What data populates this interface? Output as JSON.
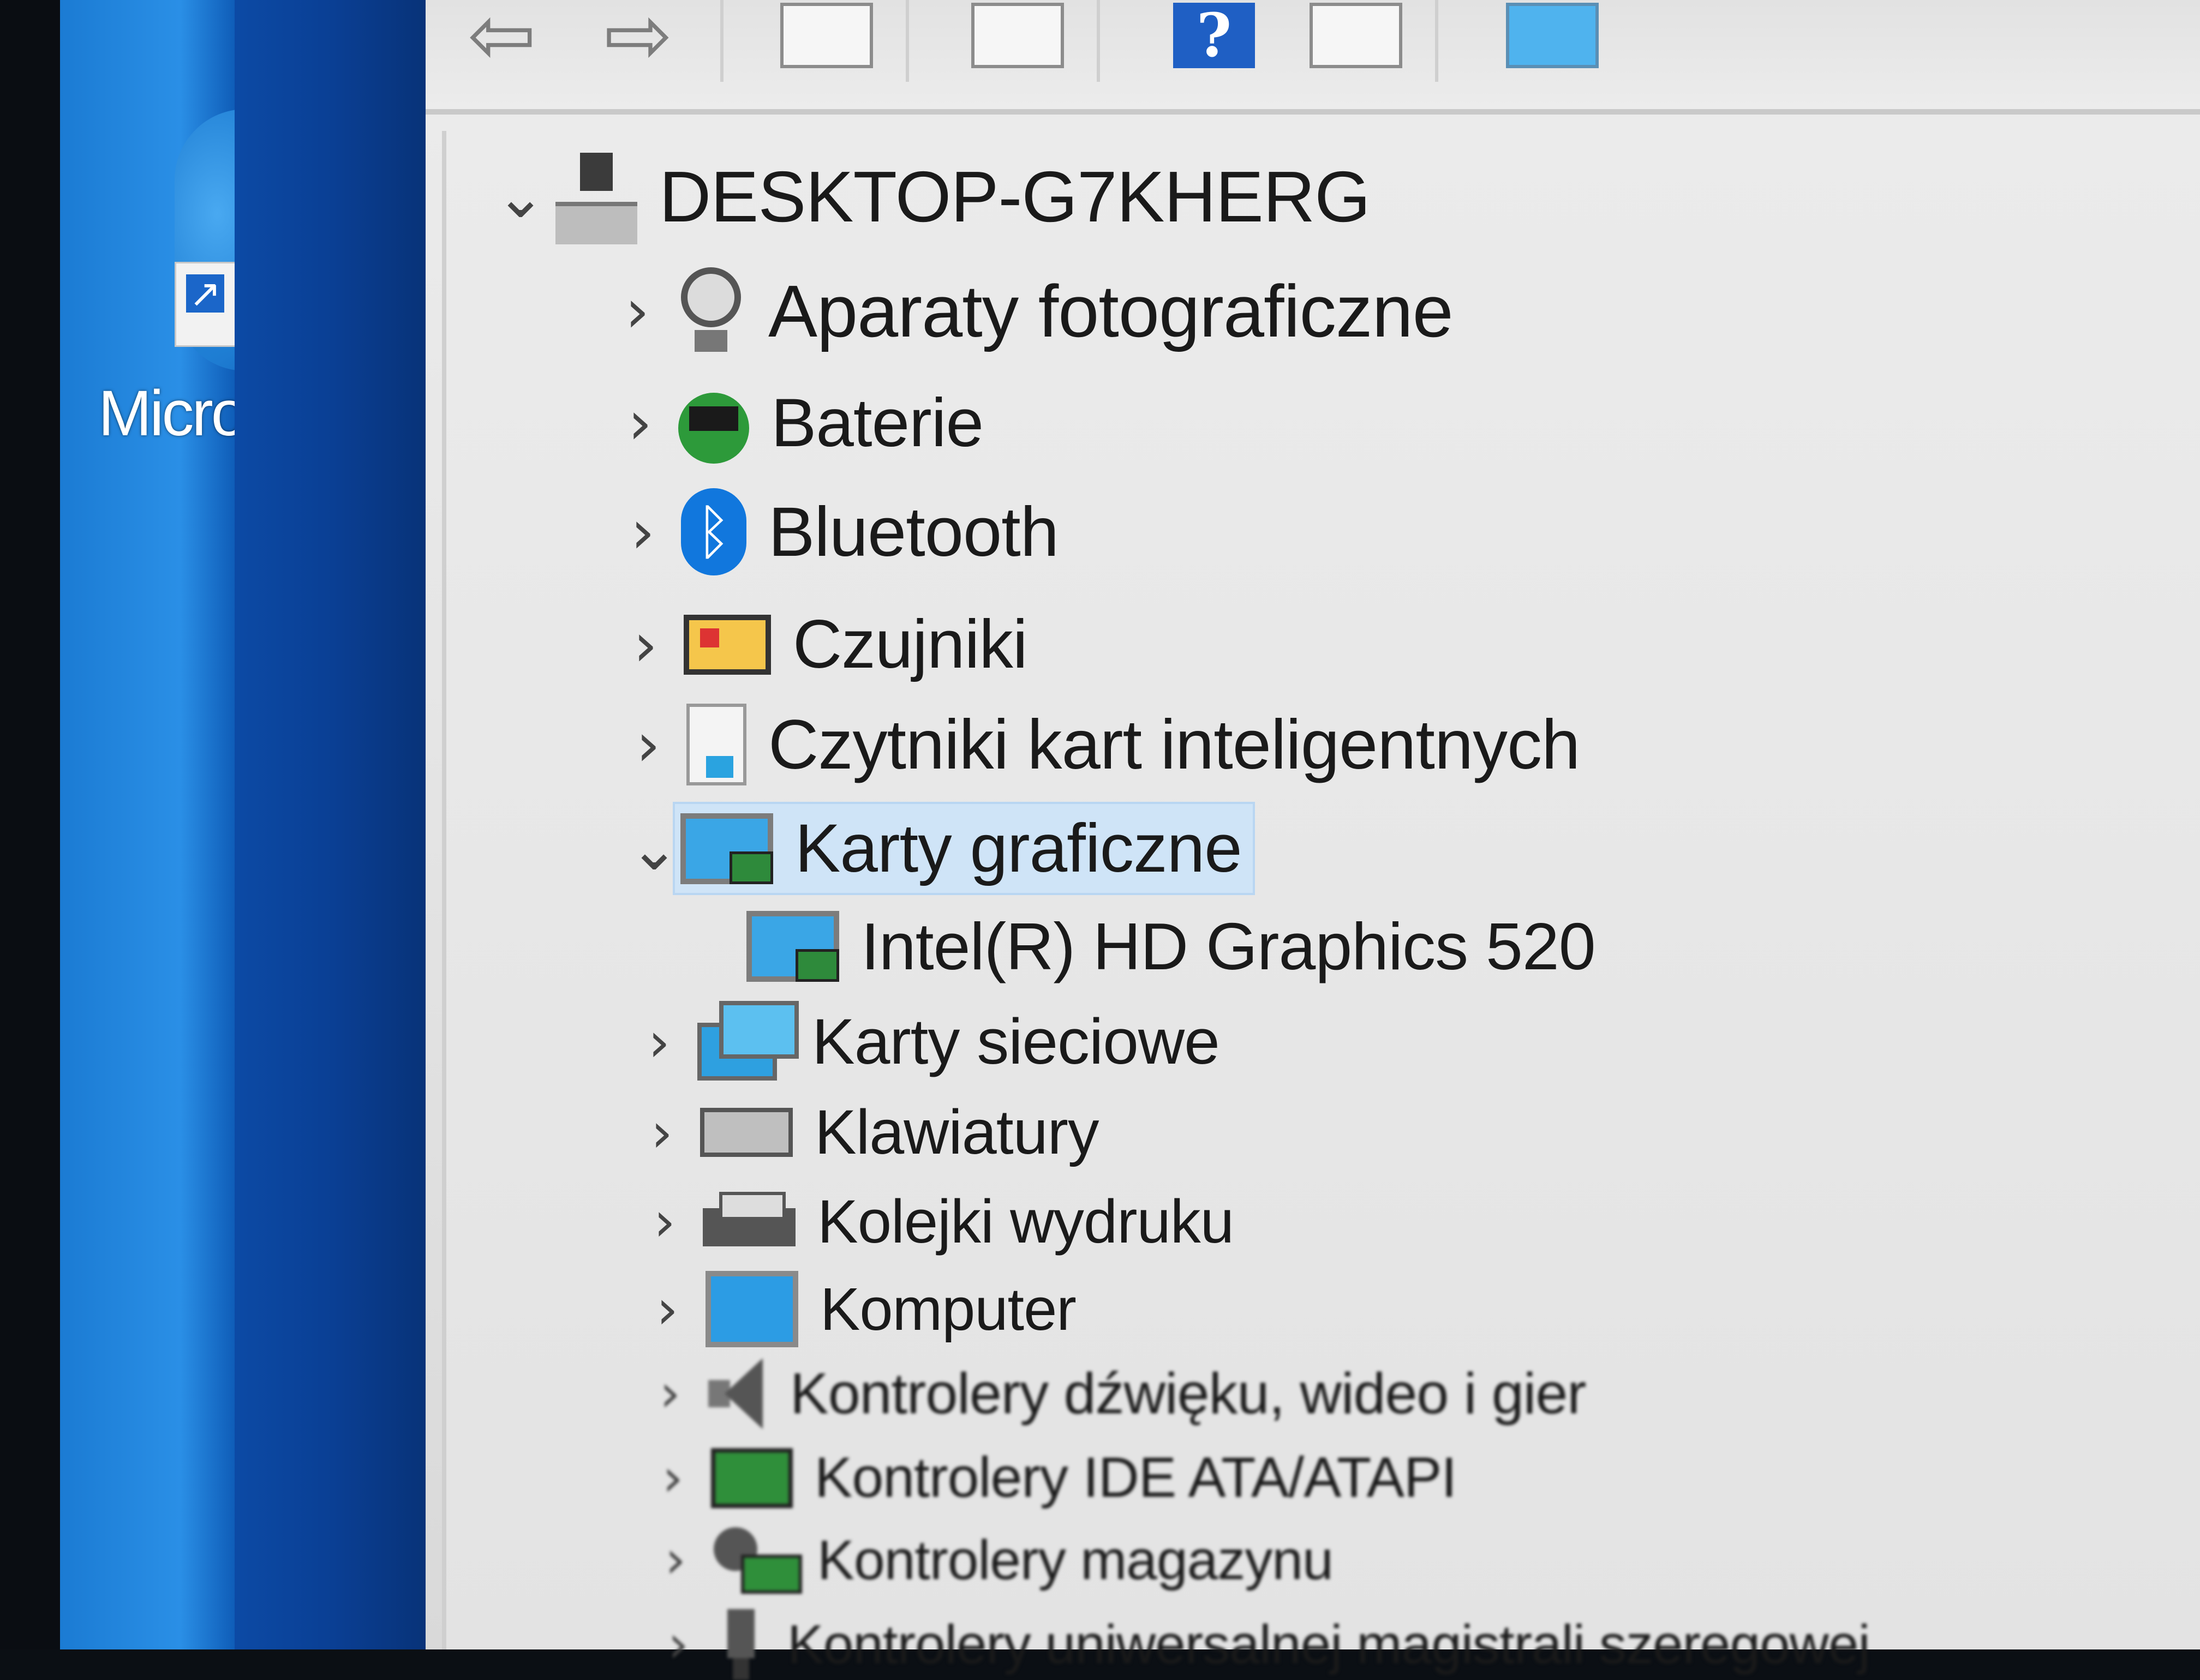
{
  "desktop": {
    "shortcut_label": "Micro"
  },
  "toolbar": {
    "back_icon": "back-arrow-icon",
    "forward_icon": "forward-arrow-icon",
    "show_hide_console_tree_icon": "console-tree-icon",
    "properties_icon": "properties-icon",
    "help_icon": "help-icon",
    "help_glyph": "?",
    "show_hide_action_pane_icon": "action-pane-icon",
    "scan_hardware_icon": "scan-hardware-icon"
  },
  "tree": {
    "root": {
      "label": "DESKTOP-G7KHERG",
      "expanded": true
    },
    "categories": [
      {
        "label": "Aparaty fotograficzne",
        "icon": "camera-icon",
        "expanded": false
      },
      {
        "label": "Baterie",
        "icon": "battery-icon",
        "expanded": false
      },
      {
        "label": "Bluetooth",
        "icon": "bluetooth-icon",
        "expanded": false
      },
      {
        "label": "Czujniki",
        "icon": "sensor-icon",
        "expanded": false
      },
      {
        "label": "Czytniki kart inteligentnych",
        "icon": "smart-card-reader-icon",
        "expanded": false
      },
      {
        "label": "Karty graficzne",
        "icon": "display-adapter-icon",
        "expanded": true,
        "selected": true,
        "children": [
          {
            "label": "Intel(R) HD Graphics 520",
            "icon": "display-adapter-icon"
          }
        ]
      },
      {
        "label": "Karty sieciowe",
        "icon": "network-adapter-icon",
        "expanded": false
      },
      {
        "label": "Klawiatury",
        "icon": "keyboard-icon",
        "expanded": false
      },
      {
        "label": "Kolejki wydruku",
        "icon": "print-queue-icon",
        "expanded": false
      },
      {
        "label": "Komputer",
        "icon": "computer-icon",
        "expanded": false
      },
      {
        "label": "Kontrolery dźwięku, wideo i gier",
        "icon": "sound-icon",
        "expanded": false
      },
      {
        "label": "Kontrolery IDE ATA/ATAPI",
        "icon": "ide-controller-icon",
        "expanded": false
      },
      {
        "label": "Kontrolery magazynu",
        "icon": "storage-controller-icon",
        "expanded": false
      },
      {
        "label": "Kontrolery uniwersalnej magistrali szeregowej",
        "icon": "usb-controller-icon",
        "expanded": false
      }
    ]
  },
  "glyphs": {
    "expanded": "⌄",
    "collapsed": "›",
    "bluetooth": "ᛒ",
    "shortcut_arrow": "↗",
    "back": "⇦",
    "forward": "⇨"
  },
  "colors": {
    "selection": "#cfe4f7",
    "window_bg": "#e8e8e8",
    "desktop_blue": "#1b7bd3"
  }
}
